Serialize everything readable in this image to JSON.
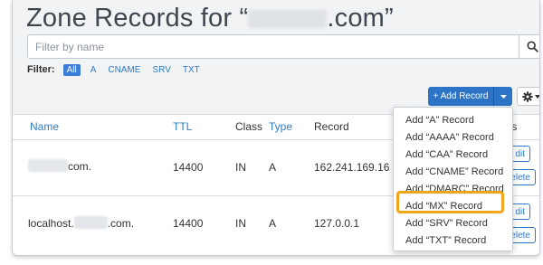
{
  "page": {
    "title_prefix": "Zone Records for “",
    "title_suffix": ".com”"
  },
  "search": {
    "placeholder": "Filter by name"
  },
  "filter": {
    "label": "Filter:",
    "chips": [
      "All",
      "A",
      "CNAME",
      "SRV",
      "TXT"
    ]
  },
  "toolbar": {
    "add_record_label": "+ Add Record"
  },
  "table": {
    "headers": {
      "name": "Name",
      "ttl": "TTL",
      "class": "Class",
      "type": "Type",
      "record": "Record",
      "actions_fragment": "ons"
    },
    "rows": [
      {
        "name_suffix": "com.",
        "ttl": "14400",
        "class": "IN",
        "type": "A",
        "record": "162.241.169.16",
        "btn1": "dit",
        "btn2": "elete"
      },
      {
        "name_prefix": "localhost.",
        "name_suffix": ".com.",
        "ttl": "14400",
        "class": "IN",
        "type": "A",
        "record": "127.0.0.1",
        "btn1": "dit",
        "btn2": "elete"
      }
    ]
  },
  "dropdown": {
    "items": [
      "Add “A” Record",
      "Add “AAAA” Record",
      "Add “CAA” Record",
      "Add “CNAME” Record",
      "Add “DMARC” Record",
      "Add “MX” Record",
      "Add “SRV” Record",
      "Add “TXT” Record"
    ],
    "highlighted_index": 5
  },
  "colors": {
    "accent": "#2d74c6",
    "link": "#2e7bc6",
    "highlight": "#f2a51a"
  },
  "icons": [
    "search-icon",
    "gear-icon",
    "caret-down-icon"
  ]
}
